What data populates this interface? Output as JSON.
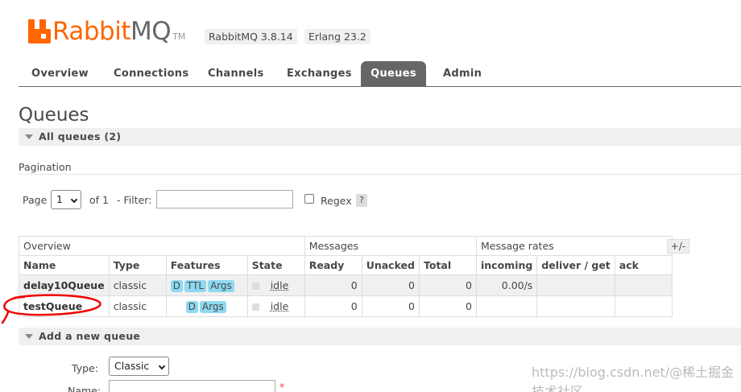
{
  "header": {
    "logo_rabbit": "Rabbit",
    "logo_mq": "MQ",
    "logo_tm": "TM",
    "rabbitmq_version": "RabbitMQ 3.8.14",
    "erlang_version": "Erlang 23.2",
    "brand_color": "#ff6600"
  },
  "tabs": [
    {
      "label": "Overview",
      "active": false
    },
    {
      "label": "Connections",
      "active": false
    },
    {
      "label": "Channels",
      "active": false
    },
    {
      "label": "Exchanges",
      "active": false
    },
    {
      "label": "Queues",
      "active": true
    },
    {
      "label": "Admin",
      "active": false
    }
  ],
  "page": {
    "title": "Queues",
    "all_queues": "All queues (2)"
  },
  "pagination": {
    "label": "Pagination",
    "page_label": "Page",
    "page_value": "1",
    "of_label": "of 1",
    "filter_label": "- Filter:",
    "filter_value": "",
    "regex_label": "Regex",
    "help": "?"
  },
  "table": {
    "groups": [
      "Overview",
      "Messages",
      "Message rates"
    ],
    "columns": [
      "Name",
      "Type",
      "Features",
      "State",
      "Ready",
      "Unacked",
      "Total",
      "incoming",
      "deliver / get",
      "ack"
    ],
    "toggle_columns": "+/-",
    "rows": [
      {
        "name": "delay10Queue",
        "type": "classic",
        "features": [
          "D",
          "TTL",
          "Args"
        ],
        "state": "idle",
        "ready": "0",
        "unacked": "0",
        "total": "0",
        "incoming": "0.00/s",
        "deliver": "",
        "ack": ""
      },
      {
        "name": "testQueue",
        "type": "classic",
        "features": [
          "D",
          "Args"
        ],
        "state": "idle",
        "ready": "0",
        "unacked": "0",
        "total": "0",
        "incoming": "",
        "deliver": "",
        "ack": ""
      }
    ]
  },
  "add_queue": {
    "section_label": "Add a new queue",
    "type_label": "Type:",
    "type_value": "Classic",
    "name_label": "Name:",
    "required_mark": "*"
  },
  "watermark": "https://blog.csdn.net/@稀土掘金技术社区"
}
